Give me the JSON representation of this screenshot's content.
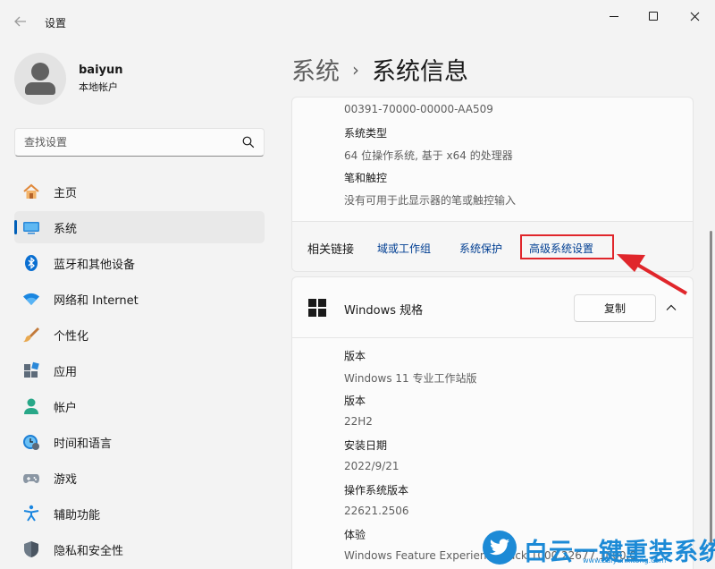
{
  "window": {
    "app_title": "设置"
  },
  "profile": {
    "name": "baiyun",
    "account_type": "本地帐户"
  },
  "search": {
    "placeholder": "查找设置"
  },
  "nav": {
    "items": [
      {
        "label": "主页",
        "icon": "home-icon"
      },
      {
        "label": "系统",
        "icon": "system-icon",
        "active": true
      },
      {
        "label": "蓝牙和其他设备",
        "icon": "bluetooth-icon"
      },
      {
        "label": "网络和 Internet",
        "icon": "wifi-icon"
      },
      {
        "label": "个性化",
        "icon": "brush-icon"
      },
      {
        "label": "应用",
        "icon": "apps-icon"
      },
      {
        "label": "帐户",
        "icon": "account-icon"
      },
      {
        "label": "时间和语言",
        "icon": "time-language-icon"
      },
      {
        "label": "游戏",
        "icon": "gamepad-icon"
      },
      {
        "label": "辅助功能",
        "icon": "accessibility-icon"
      },
      {
        "label": "隐私和安全性",
        "icon": "shield-icon"
      }
    ]
  },
  "breadcrumb": {
    "parent": "系统",
    "separator": "›",
    "current": "系统信息"
  },
  "device_specs": {
    "product_id": "00391-70000-00000-AA509",
    "system_type_label": "系统类型",
    "system_type_value": "64 位操作系统, 基于 x64 的处理器",
    "pen_touch_label": "笔和触控",
    "pen_touch_value": "没有可用于此显示器的笔或触控输入"
  },
  "related_links": {
    "title": "相关链接",
    "links": [
      "域或工作组",
      "系统保护",
      "高级系统设置"
    ]
  },
  "windows_specs": {
    "title": "Windows 规格",
    "copy_label": "复制",
    "rows": [
      {
        "label": "版本",
        "value": "Windows 11 专业工作站版"
      },
      {
        "label": "版本",
        "value": "22H2"
      },
      {
        "label": "安装日期",
        "value": "2022/9/21"
      },
      {
        "label": "操作系统版本",
        "value": "22621.2506"
      },
      {
        "label": "体验",
        "value": "Windows Feature Experience Pack 1000.22677.1000.0"
      }
    ]
  },
  "watermark": {
    "text": "白云一键重装系统",
    "url": "www.baiyunxitong.com"
  },
  "colors": {
    "accent": "#005fb8",
    "link": "#003e92",
    "highlight": "#e0262b",
    "watermark": "#1c8ad6"
  }
}
